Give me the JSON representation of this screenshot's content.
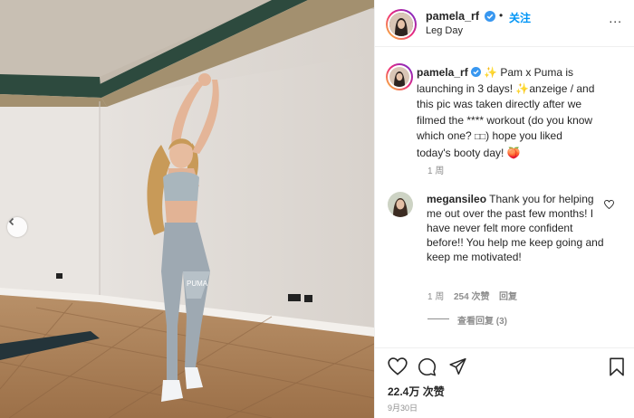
{
  "header": {
    "username": "pamela_rf",
    "follow_label": "关注",
    "separator": "•",
    "location": "Leg Day",
    "more_label": "..."
  },
  "caption": {
    "username": "pamela_rf",
    "text_before": " ✨ Pam x Puma is launching in 3 days! ✨anzeige / and this pic was taken directly after we filmed the **** workout (do you know which one? ",
    "text_boxes": "□□",
    "text_after": ") hope you liked today's booty day! 🍑",
    "time": "1 周"
  },
  "comment": {
    "username": "megansileo",
    "text": " Thank you for helping me out over the past few months! I have never felt more confident before!! You help me keep going and keep me motivated!",
    "time": "1 周",
    "likes": "254 次赞",
    "reply_label": "回复",
    "view_replies": "查看回复 (3)"
  },
  "actions": {
    "likes_count": "22.4万 次赞",
    "date": "9月30日"
  },
  "colors": {
    "link": "#0095f6",
    "verified": "#3897f0",
    "muted": "#8e8e8e"
  }
}
